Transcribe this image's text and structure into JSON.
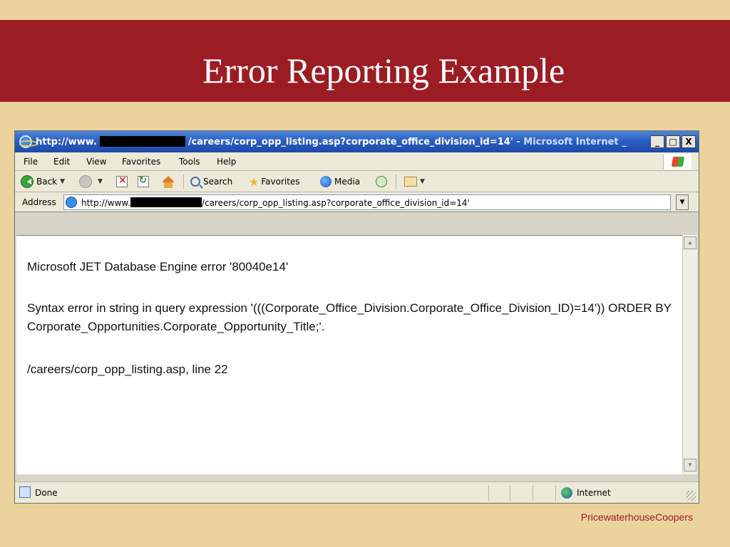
{
  "slide": {
    "title": "Error Reporting Example",
    "footer_brand": "PricewaterhouseCoopers"
  },
  "browser": {
    "title_prefix": "http://www.",
    "title_suffix": "/careers/corp_opp_listing.asp?corporate_office_division_id=14'",
    "title_app": "- Microsoft Internet _",
    "window_buttons": [
      "_",
      "□",
      "X"
    ],
    "menu": [
      "File",
      "Edit",
      "View",
      "Favorites",
      "Tools",
      "Help"
    ],
    "toolbar": {
      "back_label": "Back",
      "search_label": "Search",
      "favorites_label": "Favorites",
      "media_label": "Media"
    },
    "address": {
      "label": "Address",
      "prefix": "http://www.",
      "suffix": "/careers/corp_opp_listing.asp?corporate_office_division_id=14'"
    },
    "content": {
      "line1": "Microsoft JET Database Engine error '80040e14'",
      "line2": "Syntax error in string in query expression '(((Corporate_Office_Division.Corporate_Office_Division_ID)=14')) ORDER BY",
      "line3": "Corporate_Opportunities.Corporate_Opportunity_Title;'.",
      "line4": "/careers/corp_opp_listing.asp, line 22"
    },
    "status": {
      "text": "Done",
      "zone": "Internet"
    }
  }
}
